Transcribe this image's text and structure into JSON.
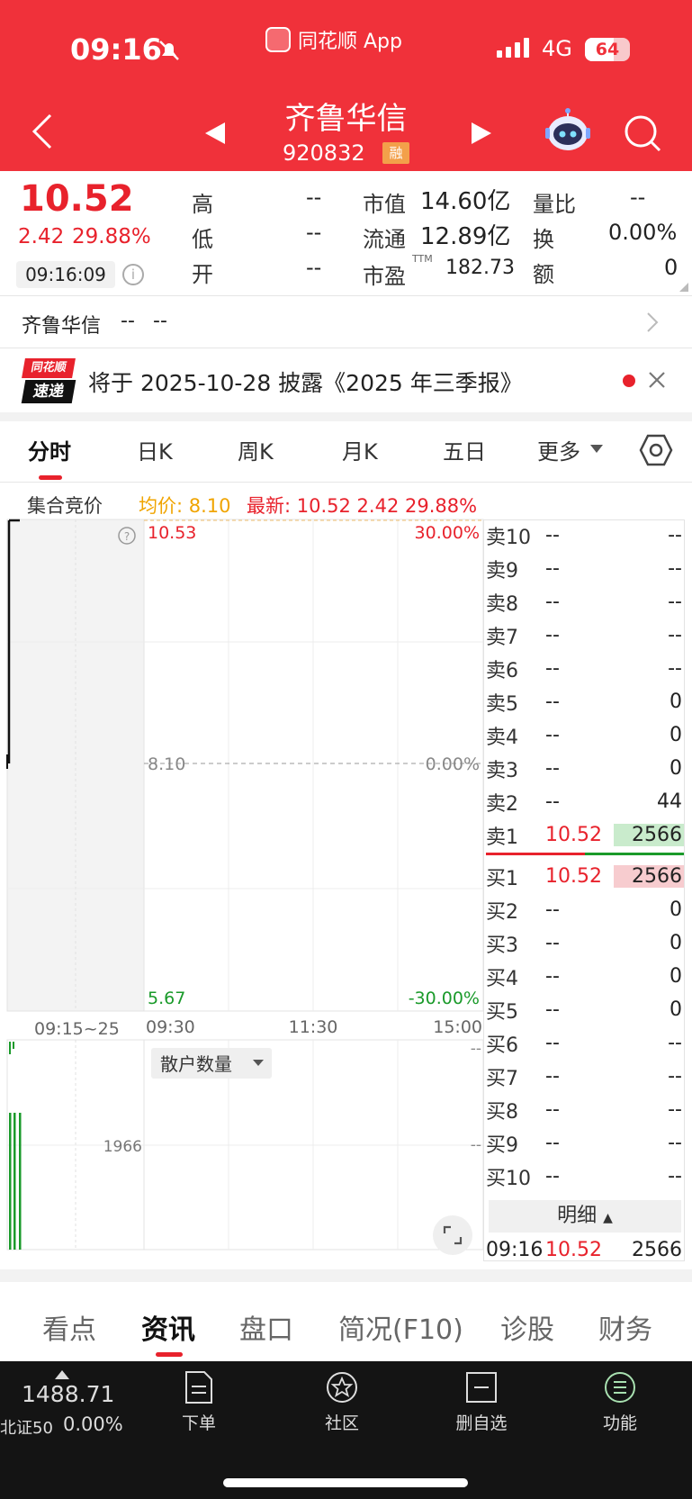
{
  "status_bar": {
    "time": "09:16",
    "app_name": "同花顺 App",
    "network": "4G",
    "battery": "64"
  },
  "nav": {
    "stock_name": "齐鲁华信",
    "stock_code": "920832",
    "badge": "融"
  },
  "quote": {
    "price": "10.52",
    "change": "2.42",
    "change_pct": "29.88%",
    "time": "09:16:09",
    "high_label": "高",
    "high_value": "--",
    "low_label": "低",
    "low_value": "--",
    "open_label": "开",
    "open_value": "--",
    "mkt_cap_label": "市值",
    "mkt_cap_value": "14.60亿",
    "float_label": "流通",
    "float_value": "12.89亿",
    "pe_label": "市盈",
    "pe_sup": "TTM",
    "pe_value": "182.73",
    "vol_ratio_label": "量比",
    "vol_ratio_value": "--",
    "turnover_label": "换",
    "turnover_value": "0.00%",
    "amount_label": "额",
    "amount_value": "0"
  },
  "related": {
    "name": "齐鲁华信",
    "v1": "--",
    "v2": "--"
  },
  "notice": {
    "badge_top": "同花顺",
    "badge_bottom": "速递",
    "text": "将于 2025-10-28 披露《2025 年三季报》"
  },
  "tabs": [
    "分时",
    "日K",
    "周K",
    "月K",
    "五日",
    "更多"
  ],
  "chart_header": {
    "title": "集合竞价",
    "avg": "均价: 8.10",
    "latest": "最新: 10.52  2.42  29.88%"
  },
  "chart_data": {
    "type": "line",
    "price_axis": {
      "max": "10.53",
      "mid": "8.10",
      "min": "5.67"
    },
    "pct_axis": {
      "max": "30.00%",
      "mid": "0.00%",
      "min": "-30.00%"
    },
    "x_labels": [
      "09:15~25",
      "09:30",
      "11:30",
      "15:00"
    ],
    "auction_volume_label": "1966",
    "volume_right_top": "--",
    "volume_right_mid": "--",
    "volume_dropdown": "散户数量"
  },
  "order_book": {
    "asks": [
      {
        "label": "卖10",
        "price": "--",
        "vol": "--"
      },
      {
        "label": "卖9",
        "price": "--",
        "vol": "--"
      },
      {
        "label": "卖8",
        "price": "--",
        "vol": "--"
      },
      {
        "label": "卖7",
        "price": "--",
        "vol": "--"
      },
      {
        "label": "卖6",
        "price": "--",
        "vol": "--"
      },
      {
        "label": "卖5",
        "price": "--",
        "vol": "0"
      },
      {
        "label": "卖4",
        "price": "--",
        "vol": "0"
      },
      {
        "label": "卖3",
        "price": "--",
        "vol": "0"
      },
      {
        "label": "卖2",
        "price": "--",
        "vol": "44"
      },
      {
        "label": "卖1",
        "price": "10.52",
        "vol": "2566"
      }
    ],
    "bids": [
      {
        "label": "买1",
        "price": "10.52",
        "vol": "2566"
      },
      {
        "label": "买2",
        "price": "--",
        "vol": "0"
      },
      {
        "label": "买3",
        "price": "--",
        "vol": "0"
      },
      {
        "label": "买4",
        "price": "--",
        "vol": "0"
      },
      {
        "label": "买5",
        "price": "--",
        "vol": "0"
      },
      {
        "label": "买6",
        "price": "--",
        "vol": "--"
      },
      {
        "label": "买7",
        "price": "--",
        "vol": "--"
      },
      {
        "label": "买8",
        "price": "--",
        "vol": "--"
      },
      {
        "label": "买9",
        "price": "--",
        "vol": "--"
      },
      {
        "label": "买10",
        "price": "--",
        "vol": "--"
      }
    ],
    "detail_label": "明细",
    "trade": {
      "time": "09:16",
      "price": "10.52",
      "vol": "2566"
    }
  },
  "bottom_tabs": [
    "看点",
    "资讯",
    "盘口",
    "简况(F10)",
    "诊股",
    "财务"
  ],
  "index": {
    "value": "1488.71",
    "name": "北证50",
    "change": "0.00%"
  },
  "bottom_nav": [
    "下单",
    "社区",
    "删自选",
    "功能"
  ],
  "colors": {
    "header": "#f0313a",
    "up": "#e8222c",
    "down": "#1a9a2a"
  }
}
